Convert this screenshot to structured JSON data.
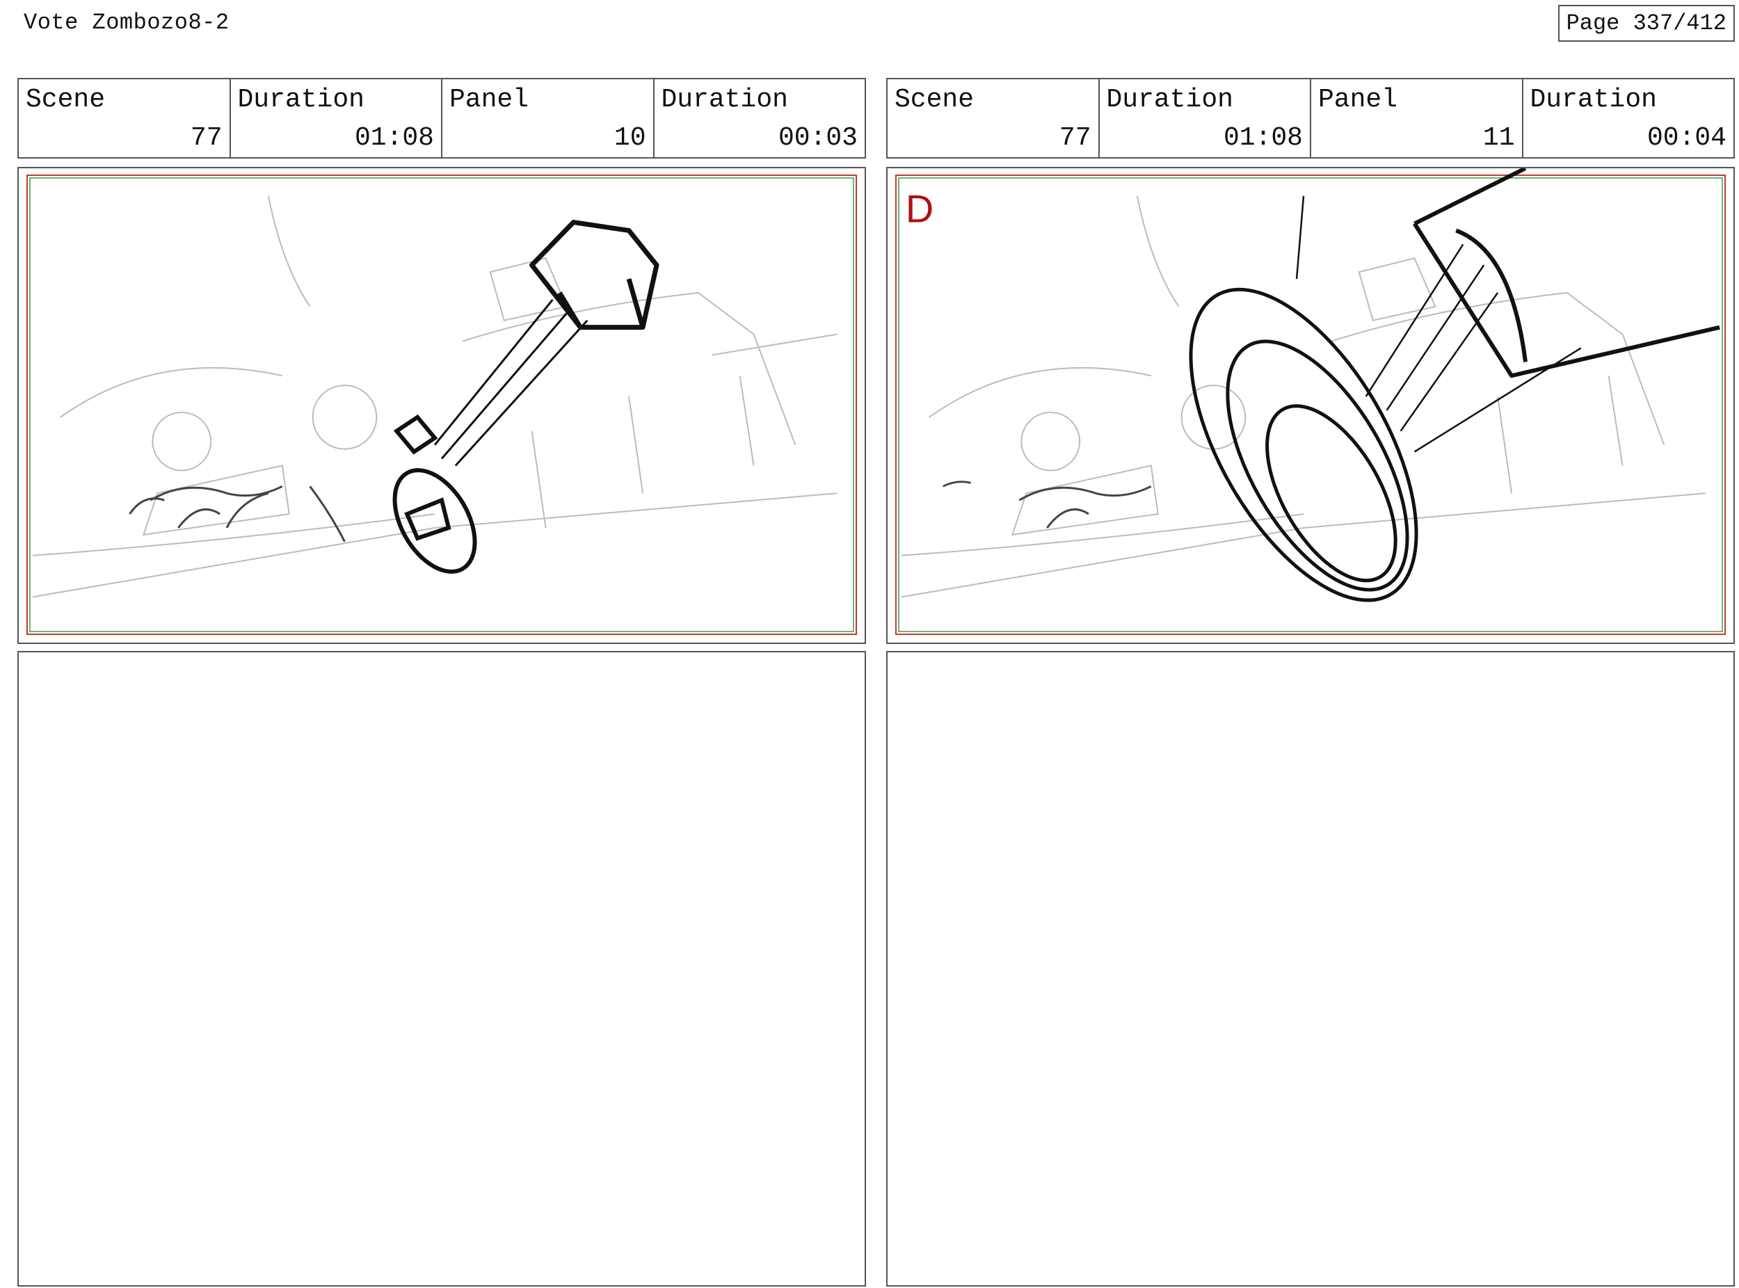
{
  "document": {
    "title": "Vote Zombozo8-2",
    "page_label": "Page 337/412"
  },
  "panels": [
    {
      "scene_label": "Scene",
      "scene_value": "77",
      "scene_duration_label": "Duration",
      "scene_duration_value": "01:08",
      "panel_label": "Panel",
      "panel_value": "10",
      "panel_duration_label": "Duration",
      "panel_duration_value": "00:03",
      "marker": ""
    },
    {
      "scene_label": "Scene",
      "scene_value": "77",
      "scene_duration_label": "Duration",
      "scene_duration_value": "01:08",
      "panel_label": "Panel",
      "panel_value": "11",
      "panel_duration_label": "Duration",
      "panel_duration_value": "00:04",
      "marker": "D"
    }
  ],
  "colors": {
    "border": "#555555",
    "safe_red": "#c0392b",
    "safe_green": "#3a9a4a",
    "marker_red": "#b01010"
  }
}
